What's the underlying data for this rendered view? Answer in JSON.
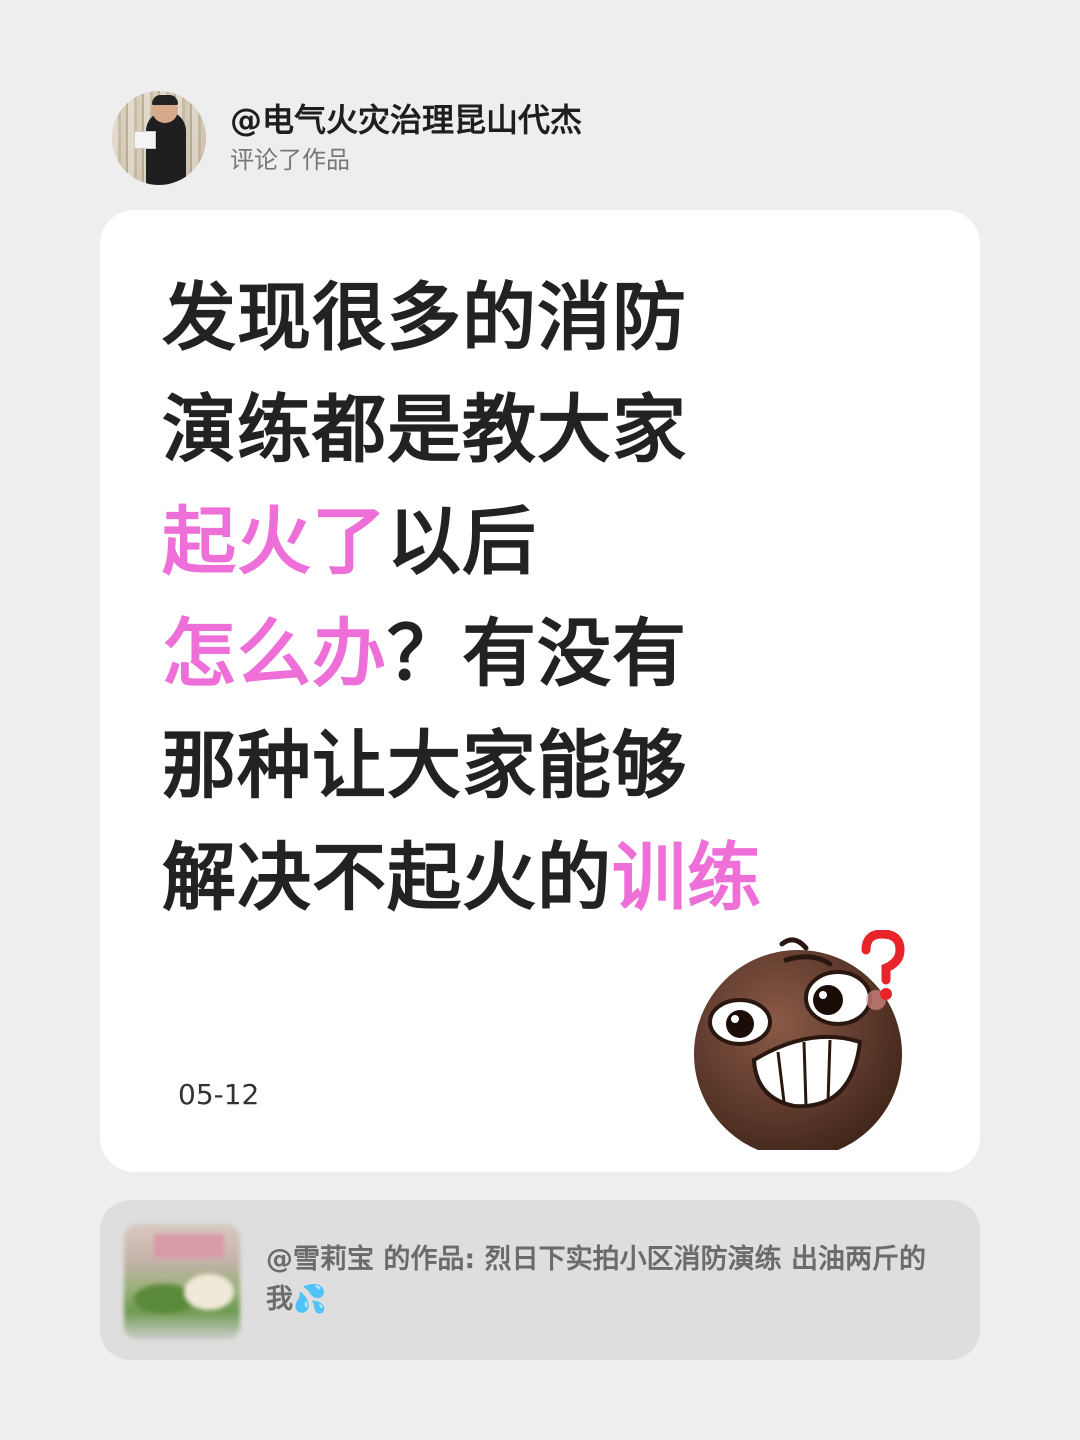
{
  "header": {
    "user_name": "@电气火灾治理昆山代杰",
    "action": "评论了作品"
  },
  "comment": {
    "lines": [
      [
        {
          "t": "发现很多的消防",
          "hl": false
        }
      ],
      [
        {
          "t": "演练都是教大家",
          "hl": false
        }
      ],
      [
        {
          "t": "起火了",
          "hl": true
        },
        {
          "t": "以后",
          "hl": false
        }
      ],
      [
        {
          "t": "怎么办",
          "hl": true
        },
        {
          "t": "？有没有",
          "hl": false
        }
      ],
      [
        {
          "t": "那种让大家能够",
          "hl": false
        }
      ],
      [
        {
          "t": "解决不起火的",
          "hl": false
        },
        {
          "t": "训练",
          "hl": true
        }
      ]
    ],
    "date": "05-12",
    "highlight_color": "#ee6fd7",
    "sticker": "confused-grin-face-with-question-mark"
  },
  "reference": {
    "text": "@雪莉宝 的作品: 烈日下实拍小区消防演练 出油两斤的我💦"
  }
}
